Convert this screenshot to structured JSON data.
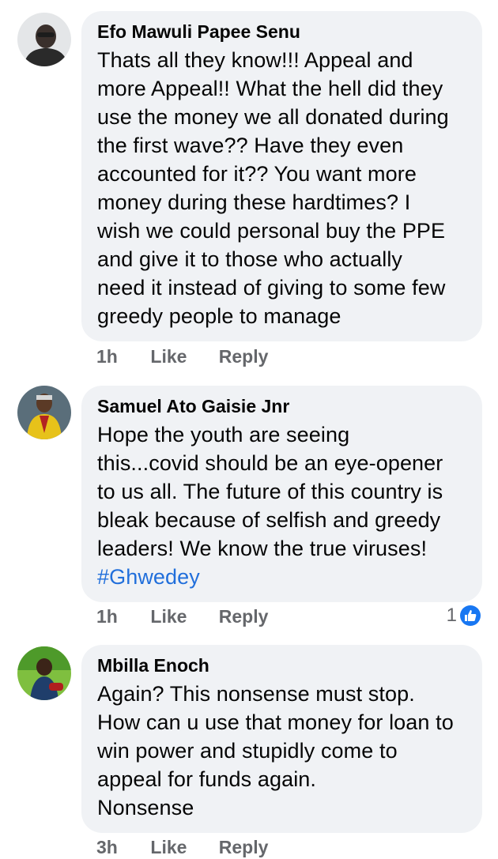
{
  "comments": [
    {
      "author": "Efo Mawuli Papee Senu",
      "lines": [
        "Thats all they know!!! Appeal and",
        "more Appeal!! What the hell did they",
        "use the money we all donated during",
        "the first wave?? Have they even",
        "accounted for it??  You want more",
        "money during these hardtimes? I",
        "wish we could personal buy the PPE",
        "and give it to those who actually",
        "need it instead of giving to some few",
        "greedy people to manage"
      ],
      "time": "1h",
      "like_label": "Like",
      "reply_label": "Reply",
      "avatar_icon": "person-avatar-icon"
    },
    {
      "author": "Samuel Ato Gaisie Jnr",
      "lines": [
        "Hope the youth are seeing",
        "this...covid should be an eye-opener",
        "to us all. The future of this country is",
        "bleak because of selfish and greedy",
        "leaders! We know the true viruses!"
      ],
      "hashtag": "#Ghwedey",
      "time": "1h",
      "like_label": "Like",
      "reply_label": "Reply",
      "reaction_count": "1",
      "avatar_icon": "person-avatar-icon"
    },
    {
      "author": "Mbilla Enoch",
      "lines": [
        "Again? This nonsense must stop.",
        "How can u use that money for loan to",
        "win power and stupidly come to",
        "appeal for funds again.",
        "Nonsense"
      ],
      "time": "3h",
      "like_label": "Like",
      "reply_label": "Reply",
      "avatar_icon": "person-avatar-icon"
    }
  ],
  "colors": {
    "bubble": "#f0f2f5",
    "text": "#050505",
    "meta": "#65676b",
    "hashtag": "#216fdb",
    "like_badge": "#1877f2"
  }
}
